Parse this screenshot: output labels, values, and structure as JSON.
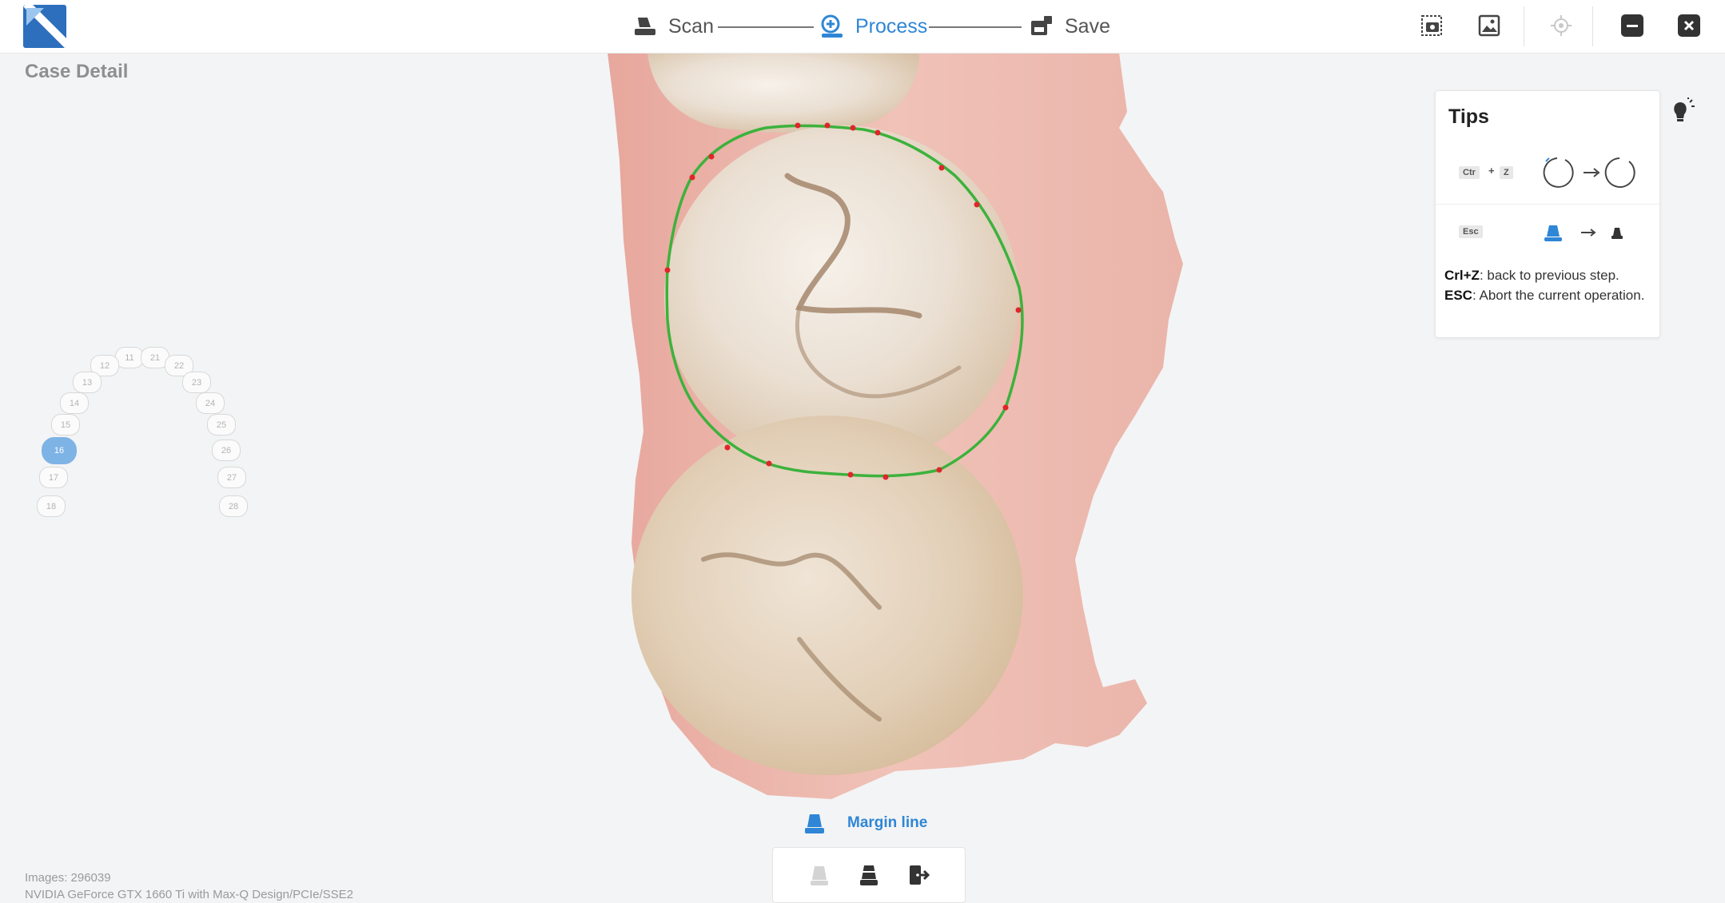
{
  "header": {
    "steps": [
      {
        "label": "Scan",
        "icon": "scanner-icon",
        "active": false
      },
      {
        "label": "Process",
        "icon": "process-icon",
        "active": true
      },
      {
        "label": "Save",
        "icon": "save-icon",
        "active": false
      }
    ],
    "tools": [
      "screenshot-icon",
      "image-view-icon",
      "locate-icon",
      "minimize-icon",
      "close-icon"
    ]
  },
  "page_title": "Case Detail",
  "tooth_chart": {
    "selected": "16",
    "upper_right": [
      "11",
      "12",
      "13",
      "14",
      "15",
      "16",
      "17",
      "18"
    ],
    "upper_left": [
      "21",
      "22",
      "23",
      "24",
      "25",
      "26",
      "27",
      "28"
    ]
  },
  "tips": {
    "title": "Tips",
    "row1_keys": [
      "Ctr",
      "Z"
    ],
    "row1_plus": "+",
    "row2_key": "Esc",
    "line1_key": "Crl+Z",
    "line1_text": ": back to previous step.",
    "line2_key": "ESC",
    "line2_text": ": Abort the current operation."
  },
  "mode": {
    "label": "Margin line"
  },
  "toolbox": [
    "margin-tool-inactive-icon",
    "margin-tool-active-icon",
    "exit-icon"
  ],
  "status": {
    "images": "Images: 296039",
    "gpu": "NVIDIA GeForce GTX 1660 Ti with Max-Q Design/PCIe/SSE2"
  },
  "colors": {
    "accent": "#2f86d6",
    "margin_line": "#3cb23c",
    "margin_points": "#e0252b",
    "selected_tooth": "#7eb3e6"
  }
}
